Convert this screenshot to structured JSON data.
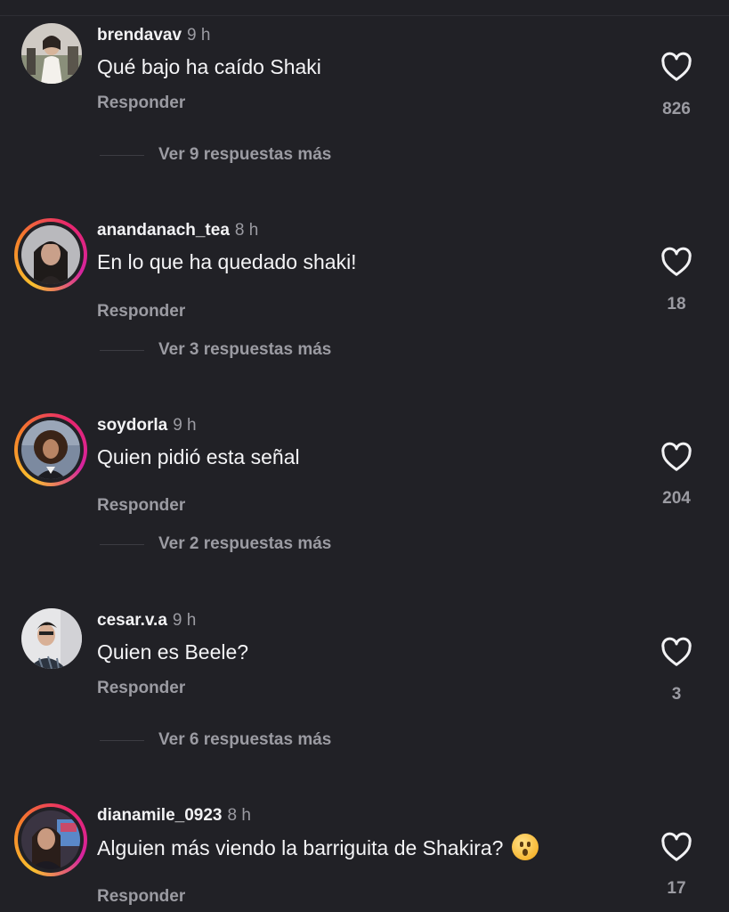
{
  "reply_label": "Responder",
  "comments": [
    {
      "username": "brendavav",
      "time": "9 h",
      "text": "Qué bajo ha caído Shaki",
      "likes": "826",
      "more_replies": "Ver 9 respuestas más",
      "has_story": false
    },
    {
      "username": "anandanach_tea",
      "time": "8 h",
      "text": "En lo que ha quedado shaki!",
      "likes": "18",
      "more_replies": "Ver 3 respuestas más",
      "has_story": true
    },
    {
      "username": "soydorla",
      "time": "9 h",
      "text": "Quien pidió esta señal",
      "likes": "204",
      "more_replies": "Ver 2 respuestas más",
      "has_story": true
    },
    {
      "username": "cesar.v.a",
      "time": "9 h",
      "text": "Quien es Beele?",
      "likes": "3",
      "more_replies": "Ver 6 respuestas más",
      "has_story": false
    },
    {
      "username": "dianamile_0923",
      "time": "8 h",
      "text": "Alguien más viendo la barriguita  de Shakira?",
      "emoji": "hushed-face-emoji",
      "likes": "17",
      "has_story": true
    }
  ],
  "colors": {
    "background": "#212126",
    "muted": "#9b9ba2",
    "story_ring": [
      "#f9c02e",
      "#e8266c",
      "#d6249f"
    ]
  }
}
